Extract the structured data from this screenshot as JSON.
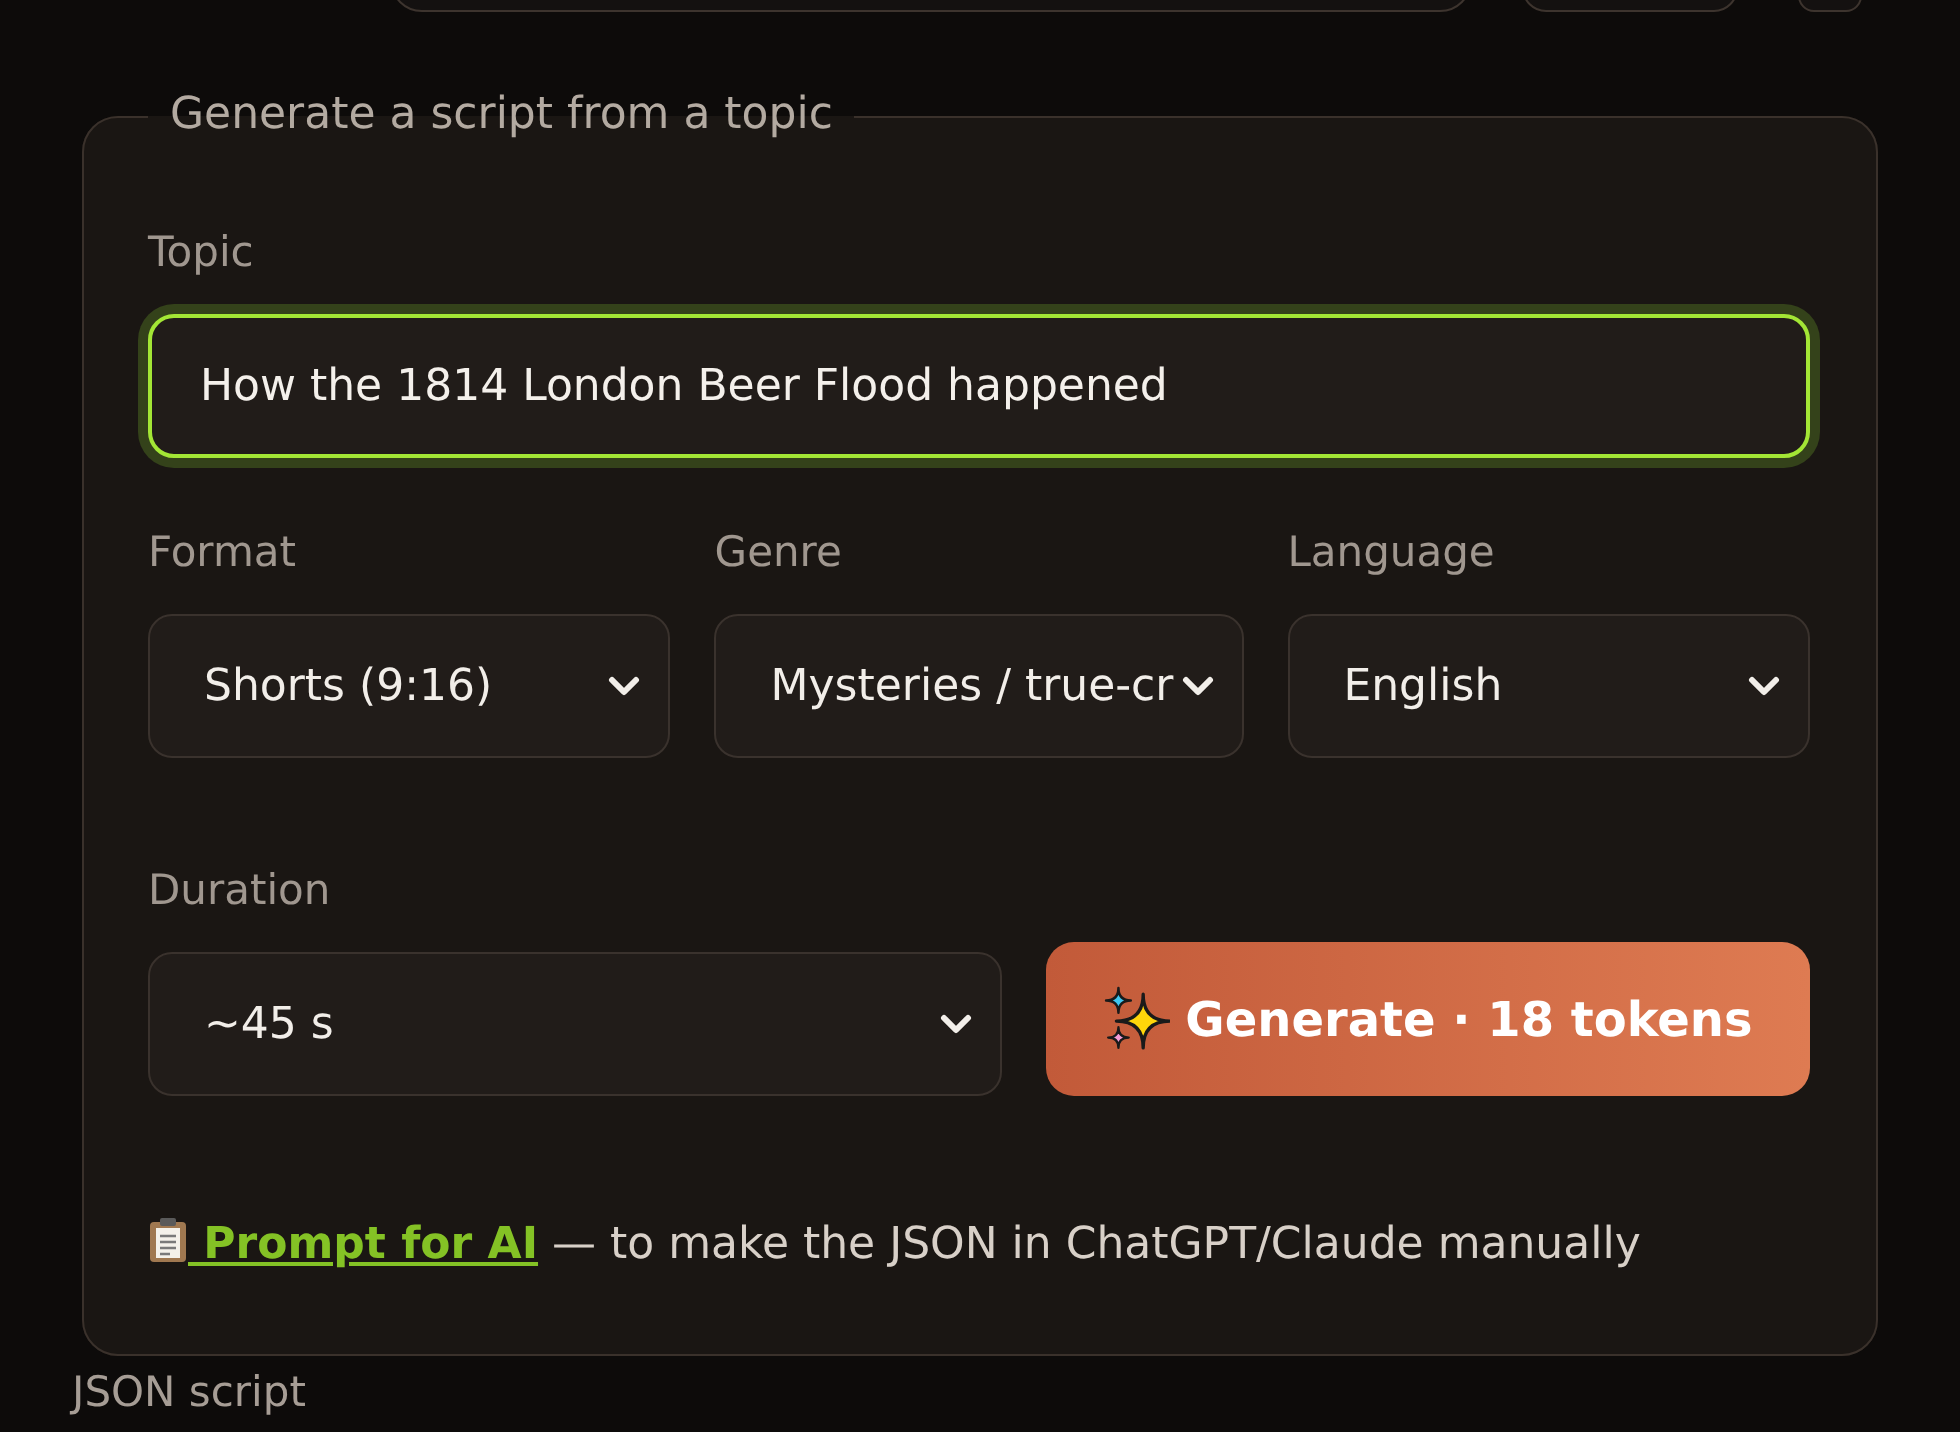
{
  "top_controls": [
    {
      "kind": "field"
    },
    {
      "kind": "button"
    },
    {
      "kind": "icon_button"
    }
  ],
  "generator": {
    "title": "Generate a script from a topic",
    "topic": {
      "label": "Topic",
      "value": "How the 1814 London Beer Flood happened",
      "focused": true
    },
    "selects": [
      {
        "label": "Format",
        "value": "Shorts (9:16)"
      },
      {
        "label": "Genre",
        "value": "Mysteries / true-cr"
      },
      {
        "label": "Language",
        "value": "English"
      }
    ],
    "duration": {
      "label": "Duration",
      "value": "~45 s"
    },
    "generate_button": {
      "label": "Generate · 18 tokens"
    },
    "prompt_note": {
      "link": "Prompt for AI",
      "text": "— to make the JSON in ChatGPT/Claude manually"
    }
  },
  "json_section": {
    "label": "JSON script"
  }
}
